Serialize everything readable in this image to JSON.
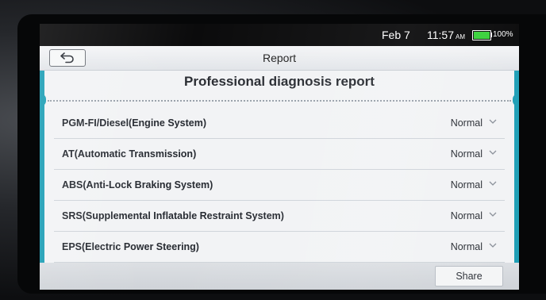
{
  "status_bar": {
    "date": "Feb 7",
    "time": "11:57",
    "ampm": "AM",
    "battery_percent": "100%",
    "battery_level": 1.0,
    "battery_color": "#39d13b"
  },
  "nav": {
    "back_icon": "back-arrow-icon",
    "title": "Report"
  },
  "report": {
    "title": "Professional diagnosis report",
    "accent_color": "#1f9fb6",
    "systems": [
      {
        "name": "PGM-FI/Diesel(Engine System)",
        "status": "Normal"
      },
      {
        "name": "AT(Automatic Transmission)",
        "status": "Normal"
      },
      {
        "name": "ABS(Anti-Lock Braking System)",
        "status": "Normal"
      },
      {
        "name": "SRS(Supplemental Inflatable Restraint System)",
        "status": "Normal"
      },
      {
        "name": "EPS(Electric Power Steering)",
        "status": "Normal"
      }
    ]
  },
  "footer": {
    "share_label": "Share"
  }
}
